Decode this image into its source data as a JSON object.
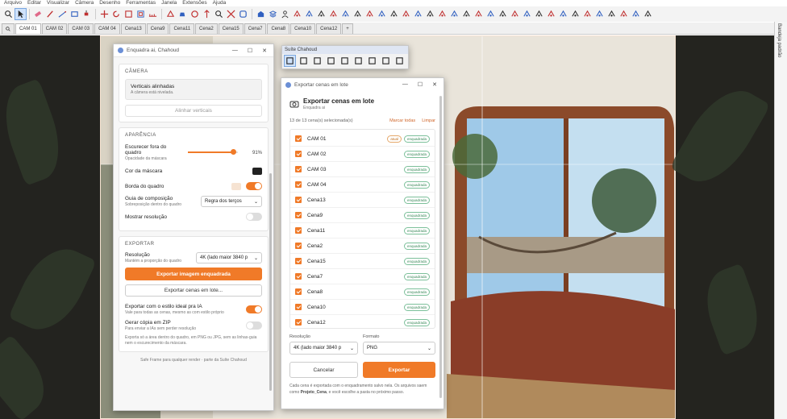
{
  "menu": [
    "Arquivo",
    "Editar",
    "Visualizar",
    "Câmera",
    "Desenho",
    "Ferramentas",
    "Janela",
    "Extensões",
    "Ajuda"
  ],
  "toolbar_icons": [
    "search-icon",
    "select-arrow-icon",
    "eraser-icon",
    "pencil-icon",
    "line-icon",
    "rectangle-icon",
    "push-pull-icon",
    "move-icon",
    "rotate-icon",
    "scale-icon",
    "offset-icon",
    "tape-measure-icon",
    "text-icon",
    "paint-bucket-icon",
    "orbit-icon",
    "pan-icon",
    "zoom-icon",
    "zoom-extents-icon",
    "component-icon",
    "warehouse-icon",
    "layers-icon",
    "user-icon"
  ],
  "tabs": [
    "CAM 01",
    "CAM 02",
    "CAM 03",
    "CAM 04",
    "Cena13",
    "Cena9",
    "Cena11",
    "Cena2",
    "Cena15",
    "Cena7",
    "Cena8",
    "Cena10",
    "Cena12"
  ],
  "tab_add": "+",
  "tray": {
    "label": "Bandeja padrão"
  },
  "left_panel": {
    "title": "Enquadra ai, Chahoud",
    "camera": {
      "section": "CÂMERA",
      "status_title": "Verticais alinhadas",
      "status_sub": "A câmera está nivelada.",
      "align_button": "Alinhar verticais"
    },
    "appearance": {
      "section": "APARÊNCIA",
      "darken_label": "Escurecer fora do quadro",
      "darken_sub": "Opacidade da máscara",
      "darken_value": "91%",
      "darken_fraction": 0.91,
      "mask_color_label": "Cor da máscara",
      "mask_color": "#222222",
      "border_label": "Borda do quadro",
      "border_color": "#f6e3d2",
      "guide_label": "Guia de composição",
      "guide_sub": "Sobreposição dentro do quadro",
      "guide_value": "Regra dos terços",
      "resolution_label": "Mostrar resolução"
    },
    "export": {
      "section": "EXPORTAR",
      "resolution_label": "Resolução",
      "resolution_sub": "Mantém a proporção do quadro",
      "resolution_value": "4K (lado maior 3840 p",
      "export_button": "Exportar imagem enquadrada",
      "batch_button": "Exportar cenas em lote...",
      "ai_style_label": "Exportar com o estilo ideal pra IA",
      "ai_style_sub": "Vale para todas as cenas, mesmo as com estilo próprio",
      "zip_label": "Gerar cópia em ZIP",
      "zip_sub": "Para enviar a IAs sem perder resolução",
      "note": "Exporta só a área dentro do quadro, em PNG ou JPG, sem as linhas-guia nem o escurecimento da máscara."
    },
    "footer": "Safe Frame para qualquer render · parte da Suíte Chahoud"
  },
  "suite": {
    "title": "Suíte Chahoud"
  },
  "dialog": {
    "window_title": "Exportar cenas em lote",
    "heading": "Exportar cenas em lote",
    "subheading": "Enquadra ai",
    "count_text": "13 de 13 cena(s) selecionada(s)",
    "mark_all": "Marcar todas",
    "clear": "Limpar",
    "scenes": [
      {
        "name": "CAM 01",
        "current": "atual",
        "status": "enquadrada"
      },
      {
        "name": "CAM 02",
        "status": "enquadrada"
      },
      {
        "name": "CAM 03",
        "status": "enquadrada"
      },
      {
        "name": "CAM 04",
        "status": "enquadrada"
      },
      {
        "name": "Cena13",
        "status": "enquadrada"
      },
      {
        "name": "Cena9",
        "status": "enquadrada"
      },
      {
        "name": "Cena11",
        "status": "enquadrada"
      },
      {
        "name": "Cena2",
        "status": "enquadrada"
      },
      {
        "name": "Cena15",
        "status": "enquadrada"
      },
      {
        "name": "Cena7",
        "status": "enquadrada"
      },
      {
        "name": "Cena8",
        "status": "enquadrada"
      },
      {
        "name": "Cena10",
        "status": "enquadrada"
      },
      {
        "name": "Cena12",
        "status": "enquadrada"
      }
    ],
    "resolution_label": "Resolução",
    "resolution_value": "4K (lado maior 3840 p",
    "format_label": "Formato",
    "format_value": "PNG",
    "cancel_button": "Cancelar",
    "export_button": "Exportar",
    "note_prefix": "Cada cena é exportada com o enquadramento salvo nela. Os arquivos saem como ",
    "note_code": "Projeto_Cena",
    "note_suffix": ", e você escolhe a pasta no próximo passo."
  },
  "colors": {
    "accent": "#f07a28",
    "badge_green": "#3a8a5a"
  }
}
